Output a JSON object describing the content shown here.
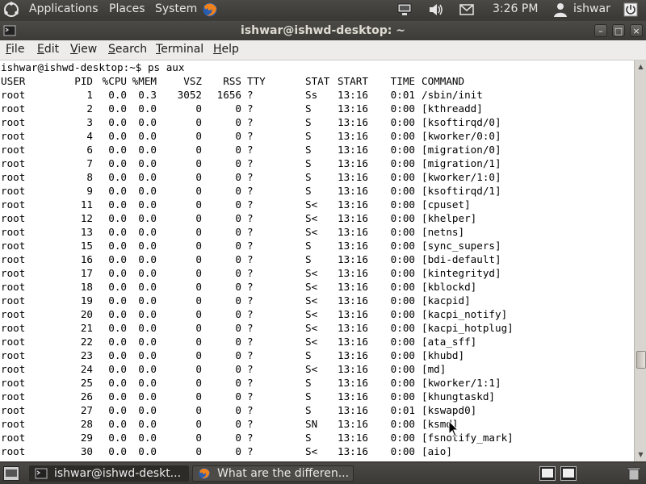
{
  "top_panel": {
    "menus": [
      "Applications",
      "Places",
      "System"
    ],
    "clock": "3:26 PM",
    "username": "ishwar",
    "icons": [
      "ubuntu-logo-icon",
      "firefox-icon",
      "network-icon",
      "volume-icon",
      "mail-icon",
      "user-icon",
      "power-icon"
    ]
  },
  "window": {
    "title": "ishwar@ishwd-desktop: ~",
    "menus": [
      "File",
      "Edit",
      "View",
      "Search",
      "Terminal",
      "Help"
    ],
    "controls": [
      "minimize",
      "maximize",
      "close"
    ]
  },
  "terminal": {
    "prompt_line": "ishwar@ishwd-desktop:~$ ps aux",
    "headers": [
      "USER",
      "PID",
      "%CPU",
      "%MEM",
      "VSZ",
      "RSS",
      "TTY",
      "STAT",
      "START",
      "TIME",
      "COMMAND"
    ],
    "rows": [
      [
        "root",
        "1",
        "0.0",
        "0.3",
        "3052",
        "1656",
        "?",
        "Ss",
        "13:16",
        "0:01",
        "/sbin/init"
      ],
      [
        "root",
        "2",
        "0.0",
        "0.0",
        "0",
        "0",
        "?",
        "S",
        "13:16",
        "0:00",
        "[kthreadd]"
      ],
      [
        "root",
        "3",
        "0.0",
        "0.0",
        "0",
        "0",
        "?",
        "S",
        "13:16",
        "0:00",
        "[ksoftirqd/0]"
      ],
      [
        "root",
        "4",
        "0.0",
        "0.0",
        "0",
        "0",
        "?",
        "S",
        "13:16",
        "0:00",
        "[kworker/0:0]"
      ],
      [
        "root",
        "6",
        "0.0",
        "0.0",
        "0",
        "0",
        "?",
        "S",
        "13:16",
        "0:00",
        "[migration/0]"
      ],
      [
        "root",
        "7",
        "0.0",
        "0.0",
        "0",
        "0",
        "?",
        "S",
        "13:16",
        "0:00",
        "[migration/1]"
      ],
      [
        "root",
        "8",
        "0.0",
        "0.0",
        "0",
        "0",
        "?",
        "S",
        "13:16",
        "0:00",
        "[kworker/1:0]"
      ],
      [
        "root",
        "9",
        "0.0",
        "0.0",
        "0",
        "0",
        "?",
        "S",
        "13:16",
        "0:00",
        "[ksoftirqd/1]"
      ],
      [
        "root",
        "11",
        "0.0",
        "0.0",
        "0",
        "0",
        "?",
        "S<",
        "13:16",
        "0:00",
        "[cpuset]"
      ],
      [
        "root",
        "12",
        "0.0",
        "0.0",
        "0",
        "0",
        "?",
        "S<",
        "13:16",
        "0:00",
        "[khelper]"
      ],
      [
        "root",
        "13",
        "0.0",
        "0.0",
        "0",
        "0",
        "?",
        "S<",
        "13:16",
        "0:00",
        "[netns]"
      ],
      [
        "root",
        "15",
        "0.0",
        "0.0",
        "0",
        "0",
        "?",
        "S",
        "13:16",
        "0:00",
        "[sync_supers]"
      ],
      [
        "root",
        "16",
        "0.0",
        "0.0",
        "0",
        "0",
        "?",
        "S",
        "13:16",
        "0:00",
        "[bdi-default]"
      ],
      [
        "root",
        "17",
        "0.0",
        "0.0",
        "0",
        "0",
        "?",
        "S<",
        "13:16",
        "0:00",
        "[kintegrityd]"
      ],
      [
        "root",
        "18",
        "0.0",
        "0.0",
        "0",
        "0",
        "?",
        "S<",
        "13:16",
        "0:00",
        "[kblockd]"
      ],
      [
        "root",
        "19",
        "0.0",
        "0.0",
        "0",
        "0",
        "?",
        "S<",
        "13:16",
        "0:00",
        "[kacpid]"
      ],
      [
        "root",
        "20",
        "0.0",
        "0.0",
        "0",
        "0",
        "?",
        "S<",
        "13:16",
        "0:00",
        "[kacpi_notify]"
      ],
      [
        "root",
        "21",
        "0.0",
        "0.0",
        "0",
        "0",
        "?",
        "S<",
        "13:16",
        "0:00",
        "[kacpi_hotplug]"
      ],
      [
        "root",
        "22",
        "0.0",
        "0.0",
        "0",
        "0",
        "?",
        "S<",
        "13:16",
        "0:00",
        "[ata_sff]"
      ],
      [
        "root",
        "23",
        "0.0",
        "0.0",
        "0",
        "0",
        "?",
        "S",
        "13:16",
        "0:00",
        "[khubd]"
      ],
      [
        "root",
        "24",
        "0.0",
        "0.0",
        "0",
        "0",
        "?",
        "S<",
        "13:16",
        "0:00",
        "[md]"
      ],
      [
        "root",
        "25",
        "0.0",
        "0.0",
        "0",
        "0",
        "?",
        "S",
        "13:16",
        "0:00",
        "[kworker/1:1]"
      ],
      [
        "root",
        "26",
        "0.0",
        "0.0",
        "0",
        "0",
        "?",
        "S",
        "13:16",
        "0:00",
        "[khungtaskd]"
      ],
      [
        "root",
        "27",
        "0.0",
        "0.0",
        "0",
        "0",
        "?",
        "S",
        "13:16",
        "0:01",
        "[kswapd0]"
      ],
      [
        "root",
        "28",
        "0.0",
        "0.0",
        "0",
        "0",
        "?",
        "SN",
        "13:16",
        "0:00",
        "[ksmd]"
      ],
      [
        "root",
        "29",
        "0.0",
        "0.0",
        "0",
        "0",
        "?",
        "S",
        "13:16",
        "0:00",
        "[fsnotify_mark]"
      ],
      [
        "root",
        "30",
        "0.0",
        "0.0",
        "0",
        "0",
        "?",
        "S<",
        "13:16",
        "0:00",
        "[aio]"
      ]
    ]
  },
  "taskbar": {
    "items": [
      {
        "label": "ishwar@ishwd-deskt...",
        "icon": "terminal-icon"
      },
      {
        "label": "What are the differen...",
        "icon": "firefox-icon"
      }
    ]
  },
  "colors": {
    "panel_bg": "#3c3b37",
    "terminal_bg": "#ffffff",
    "terminal_fg": "#000000",
    "menubar_bg": "#edeceb"
  }
}
